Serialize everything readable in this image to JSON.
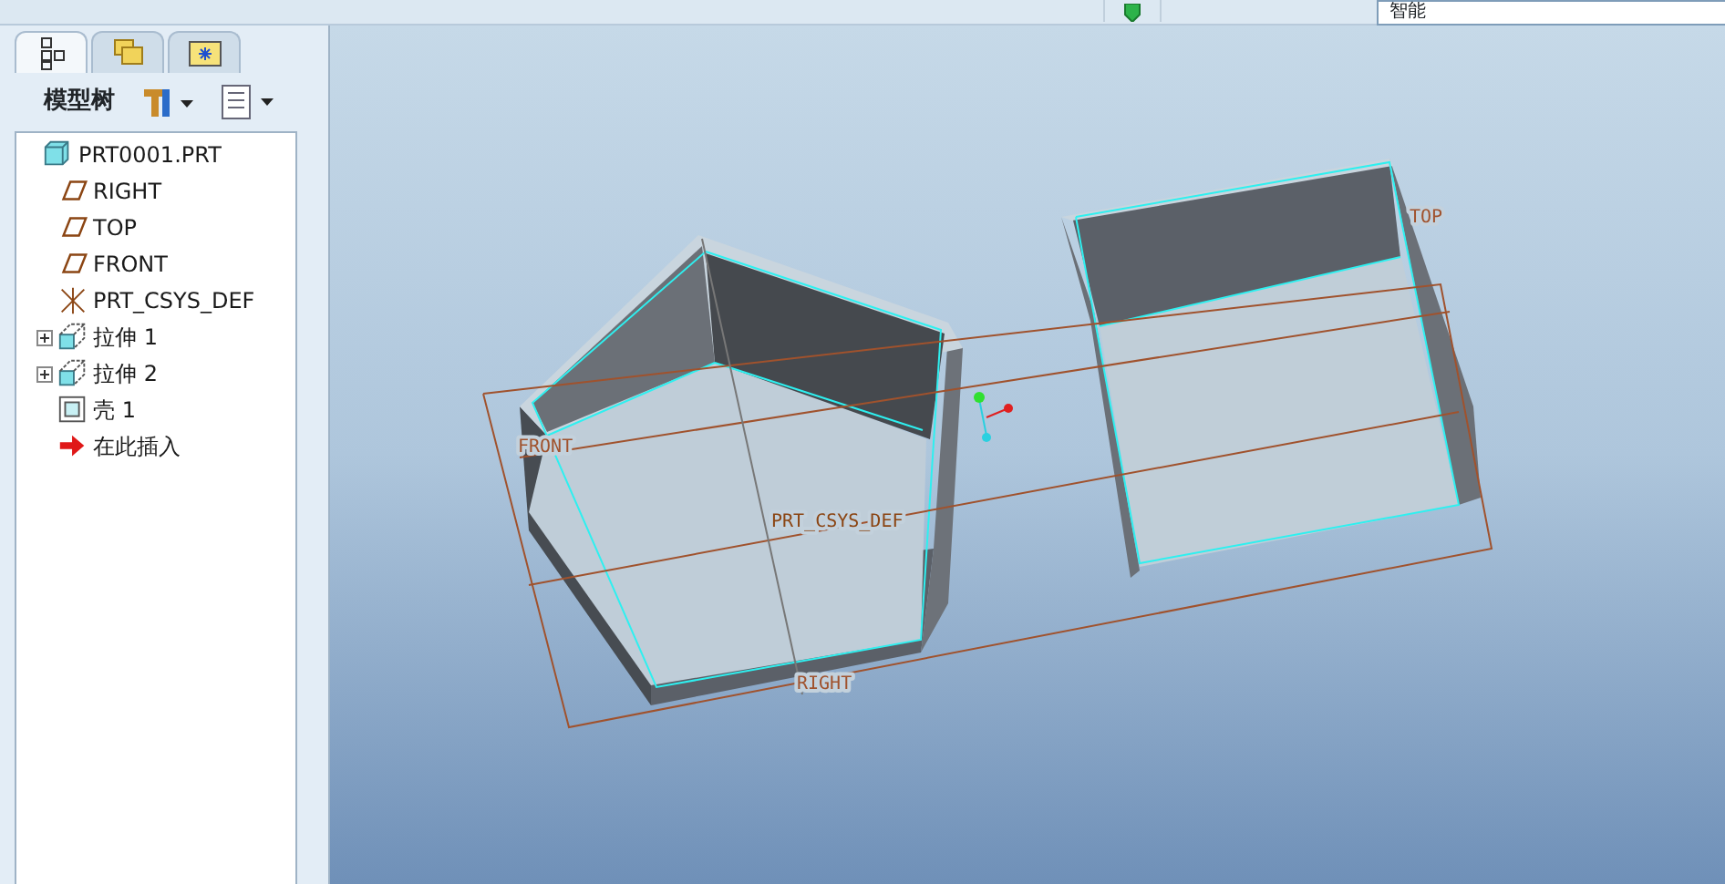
{
  "top_bar": {
    "filter_value": "智能"
  },
  "tabs": [
    {
      "kind": "tree",
      "selected": true
    },
    {
      "kind": "folders",
      "selected": false
    },
    {
      "kind": "favorites",
      "selected": false
    }
  ],
  "panel": {
    "title": "模型树"
  },
  "tree": [
    {
      "label": "PRT0001.PRT",
      "kind": "part",
      "expandable": false,
      "children": [
        {
          "label": "RIGHT",
          "kind": "plane",
          "expandable": false
        },
        {
          "label": "TOP",
          "kind": "plane",
          "expandable": false
        },
        {
          "label": "FRONT",
          "kind": "plane",
          "expandable": false
        },
        {
          "label": "PRT_CSYS_DEF",
          "kind": "csys",
          "expandable": false
        },
        {
          "label": "拉伸 1",
          "kind": "extrude",
          "expandable": true
        },
        {
          "label": "拉伸 2",
          "kind": "extrude",
          "expandable": true
        },
        {
          "label": "壳 1",
          "kind": "shell",
          "expandable": false
        },
        {
          "label": "在此插入",
          "kind": "insert",
          "expandable": false
        }
      ]
    }
  ],
  "viewport": {
    "labels": [
      {
        "text": "TOP",
        "kind": "plane"
      },
      {
        "text": "FRONT",
        "kind": "plane"
      },
      {
        "text": "PRT_CSYS_DEF",
        "kind": "csys"
      },
      {
        "text": "RIGHT",
        "kind": "plane"
      }
    ]
  }
}
